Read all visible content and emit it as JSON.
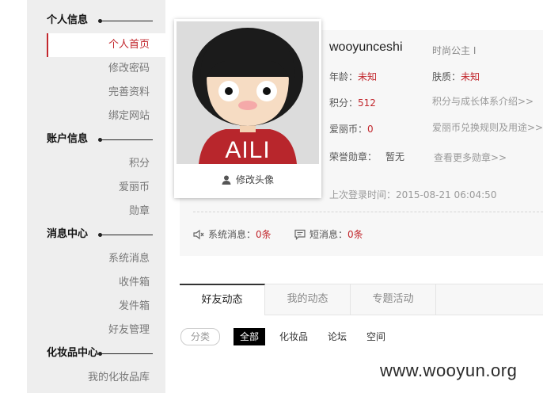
{
  "sidebar": {
    "sections": [
      {
        "title": "个人信息",
        "items": [
          "个人首页",
          "修改密码",
          "完善资料",
          "绑定网站"
        ]
      },
      {
        "title": "账户信息",
        "items": [
          "积分",
          "爱丽币",
          "勋章"
        ]
      },
      {
        "title": "消息中心",
        "items": [
          "系统消息",
          "收件箱",
          "发件箱",
          "好友管理"
        ]
      },
      {
        "title": "化妆品中心",
        "items": [
          "我的化妆品库"
        ]
      }
    ],
    "active_item": "个人首页"
  },
  "profile": {
    "avatar_text": "AILI",
    "edit_avatar_label": "修改头像",
    "username": "wooyunceshi",
    "title": "时尚公主 I",
    "age_label": "年龄：",
    "age_value": "未知",
    "skin_label": "肤质：",
    "skin_value": "未知",
    "points_label": "积分：",
    "points_value": "512",
    "points_link": "积分与成长体系介绍>>",
    "coins_label": "爱丽币：",
    "coins_value": "0",
    "coins_link": "爱丽币兑换规则及用途>>",
    "medal_label": "荣誉勋章：",
    "medal_value": "暂无",
    "medal_link": "查看更多勋章>>",
    "last_login": "上次登录时间：2015-08-21 06:04:50"
  },
  "messages": {
    "system_label": "系统消息：",
    "system_count": "0条",
    "short_label": "短消息：",
    "short_count": "0条"
  },
  "tabs": [
    "好友动态",
    "我的动态",
    "专题活动"
  ],
  "filter": {
    "label": "分类",
    "items": [
      "全部",
      "化妆品",
      "论坛",
      "空间"
    ]
  },
  "watermark": "www.wooyun.org",
  "colors": {
    "accent": "#c2272d",
    "sidebar_bg": "#eeeeee",
    "panel_bg": "#f7f7f7"
  }
}
